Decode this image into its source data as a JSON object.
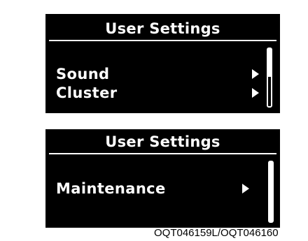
{
  "screens": {
    "top": {
      "title": "User Settings",
      "items": [
        {
          "label": "Sound",
          "icon": "chevron-right-icon"
        },
        {
          "label": "Cluster",
          "icon": "chevron-right-icon"
        }
      ]
    },
    "bottom": {
      "title": "User Settings",
      "items": [
        {
          "label": "Maintenance",
          "icon": "chevron-right-icon"
        }
      ]
    }
  },
  "caption": "OQT046159L/OQT046160",
  "colors": {
    "screen_background": "#000000",
    "screen_text": "#ffffff",
    "page_background": "#ffffff"
  }
}
